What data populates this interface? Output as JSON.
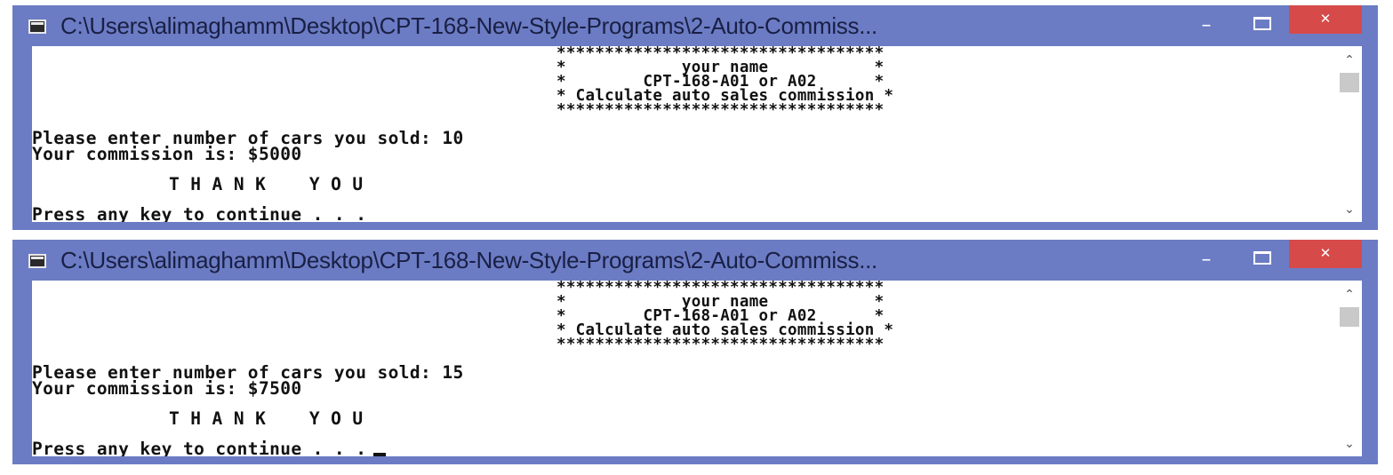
{
  "windows": [
    {
      "title": "C:\\Users\\alimaghamm\\Desktop\\CPT-168-New-Style-Programs\\2-Auto-Commiss...",
      "controls": {
        "minimize": "–",
        "close": "✕"
      },
      "console": {
        "banner": [
          "**********************************",
          "*            your name           *",
          "*        CPT-168-A01 or A02      *",
          "* Calculate auto sales commission *",
          "**********************************"
        ],
        "prompt": "Please enter number of cars you sold: 10",
        "commission": "Your commission is: $5000",
        "thanks": "T H A N K    Y O U",
        "press": "Press any key to continue . . ."
      },
      "scrollbar": {
        "up": "⌃",
        "down": "⌄"
      }
    },
    {
      "title": "C:\\Users\\alimaghamm\\Desktop\\CPT-168-New-Style-Programs\\2-Auto-Commiss...",
      "controls": {
        "minimize": "–",
        "close": "✕"
      },
      "console": {
        "banner": [
          "**********************************",
          "*            your name           *",
          "*        CPT-168-A01 or A02      *",
          "* Calculate auto sales commission *",
          "**********************************"
        ],
        "prompt": "Please enter number of cars you sold: 15",
        "commission": "Your commission is: $7500",
        "thanks": "T H A N K    Y O U",
        "press": "Press any key to continue . . ."
      },
      "scrollbar": {
        "up": "⌃",
        "down": "⌄"
      }
    }
  ],
  "colors": {
    "window_frame": "#6b7cc4",
    "close_button": "#d64a4a",
    "console_bg": "#ffffff",
    "console_text": "#111111"
  }
}
